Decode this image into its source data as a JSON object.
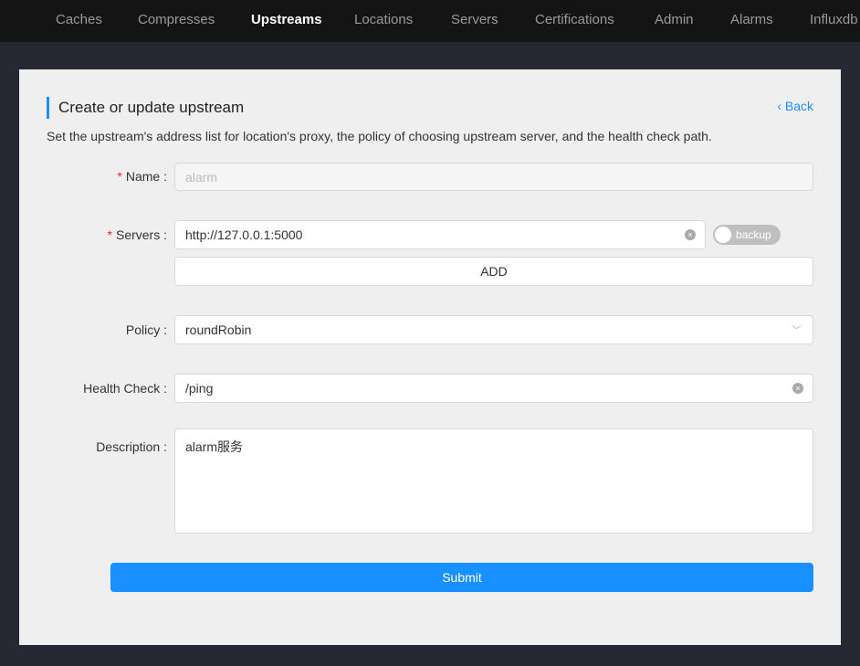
{
  "nav": [
    "Caches",
    "Compresses",
    "Upstreams",
    "Locations",
    "Servers",
    "Certifications",
    "Admin",
    "Alarms",
    "Influxdb"
  ],
  "title": "Create or update upstream",
  "back": "Back",
  "description": "Set the upstream's address list for location's proxy, the policy of choosing upstream server, and the health check path.",
  "form": {
    "name_label": "Name",
    "name_value": "alarm",
    "servers_label": "Servers",
    "server_value": "http://127.0.0.1:5000",
    "backup_label": "backup",
    "add_label": "ADD",
    "policy_label": "Policy",
    "policy_value": "roundRobin",
    "health_label": "Health Check",
    "health_value": "/ping",
    "desc_label": "Description",
    "desc_value": "alarm服务",
    "submit": "Submit"
  }
}
